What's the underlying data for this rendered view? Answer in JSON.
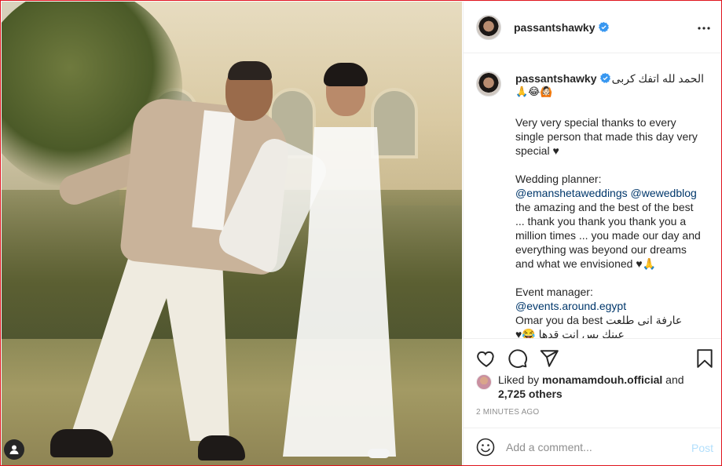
{
  "post": {
    "username": "passantshawky",
    "verified": true
  },
  "caption": {
    "username": "passantshawky",
    "arabic_title": "الحمد لله اتفك كربى",
    "title_emojis": "🙏😂🙆🏻",
    "para_thanks": "Very very special thanks to every single person that made this day very special ♥",
    "planner_label": "Wedding planner:",
    "planner_mention_1": "@emanshetaweddings",
    "planner_mention_2": "@wewedblog",
    "planner_text": "the amazing and the best of the best ... thank you thank you thank you a million times ... you made our day and everything was beyond our dreams and what we envisioned ♥🙏",
    "event_label": "Event manager:",
    "event_mention": "@events.around.egypt",
    "event_line_2": "Omar you da best عارفة انى طلعت",
    "event_line_3": "عينك بس انت قدها 😂♥"
  },
  "likes": {
    "prefix": "Liked by",
    "liker": "monamamdouh.official",
    "joiner": "and",
    "others": "2,725 others"
  },
  "timestamp": "2 MINUTES AGO",
  "comment": {
    "placeholder": "Add a comment...",
    "post_label": "Post"
  },
  "icons": {
    "more": "more-horizontal-icon",
    "like": "heart-icon",
    "comment": "comment-bubble-icon",
    "share": "paper-plane-icon",
    "save": "bookmark-icon",
    "emoji": "smiley-icon",
    "tag": "person-tag-icon"
  },
  "colors": {
    "verified": "#3897f0",
    "mention": "#00376b",
    "post_disabled": "#b2dffc",
    "frame": "#e0141e"
  }
}
